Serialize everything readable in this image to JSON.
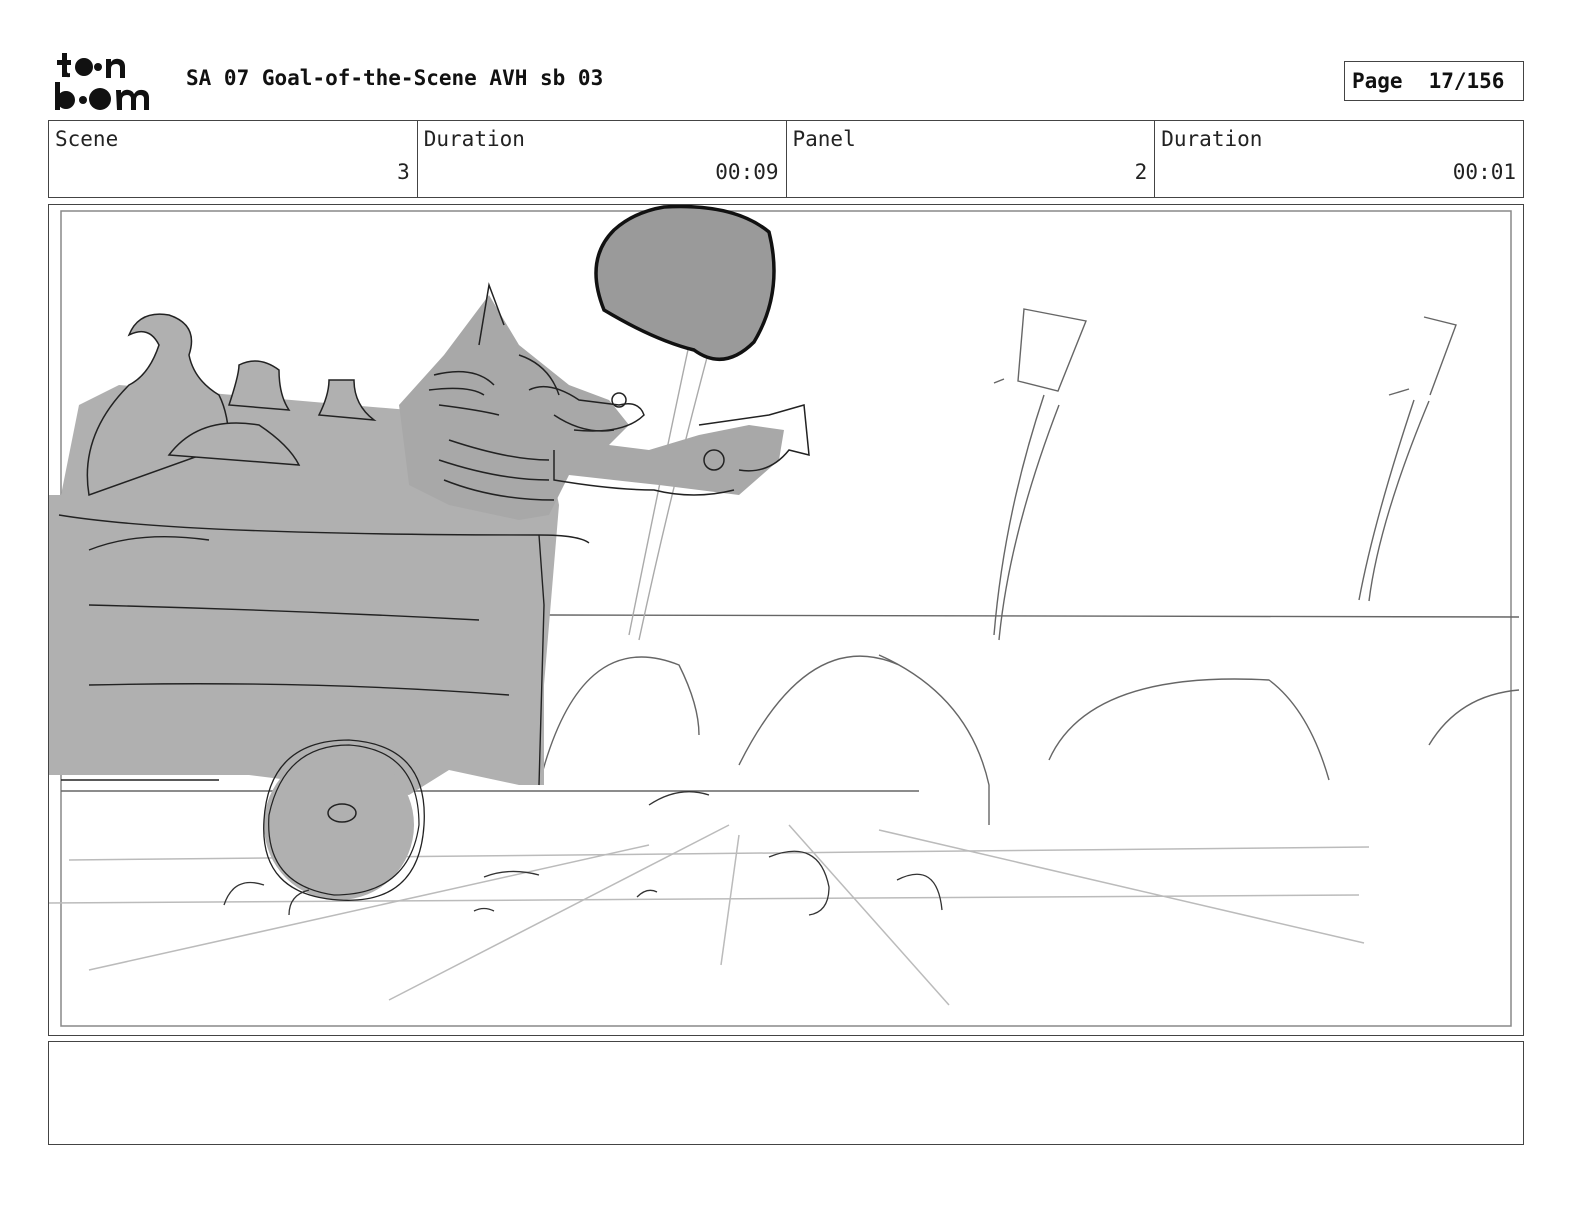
{
  "header": {
    "logo_text": "toon boom",
    "title": "SA 07 Goal-of-the-Scene AVH sb 03",
    "page_label": "Page",
    "page_number": "17/156"
  },
  "info": {
    "scene_label": "Scene",
    "scene_value": "3",
    "scene_duration_label": "Duration",
    "scene_duration_value": "00:09",
    "panel_label": "Panel",
    "panel_value": "2",
    "panel_duration_label": "Duration",
    "panel_duration_value": "00:01"
  },
  "notes": {
    "text": ""
  },
  "colors": {
    "fill_gray": "#b0b0b0",
    "dark_gray": "#999999",
    "stroke": "#222222"
  }
}
